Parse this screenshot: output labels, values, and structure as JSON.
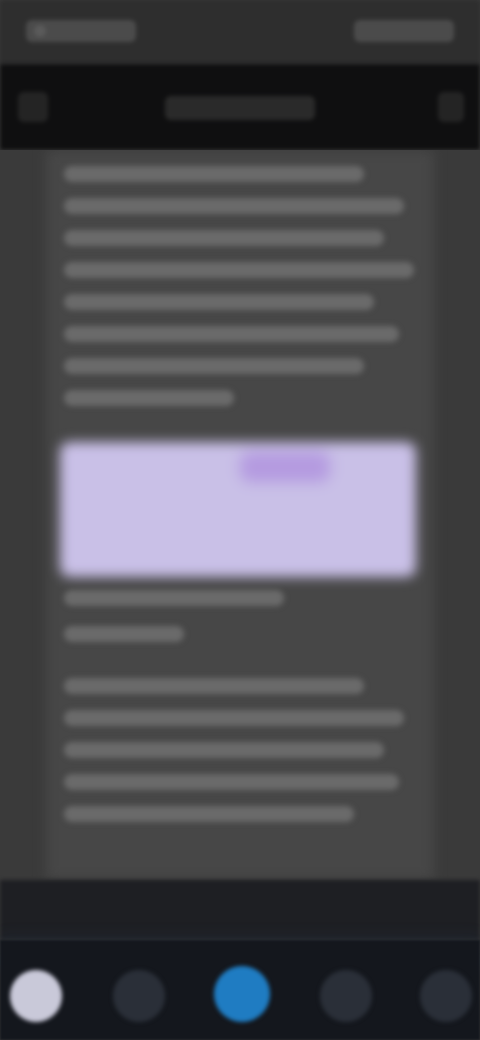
{
  "status_bar": {},
  "app_bar": {},
  "content": {},
  "bottom_nav": {
    "items": [
      {
        "icon": "profile-icon"
      },
      {
        "icon": "grid-icon"
      },
      {
        "icon": "play-icon"
      },
      {
        "icon": "pages-icon"
      },
      {
        "icon": "more-icon"
      }
    ]
  }
}
